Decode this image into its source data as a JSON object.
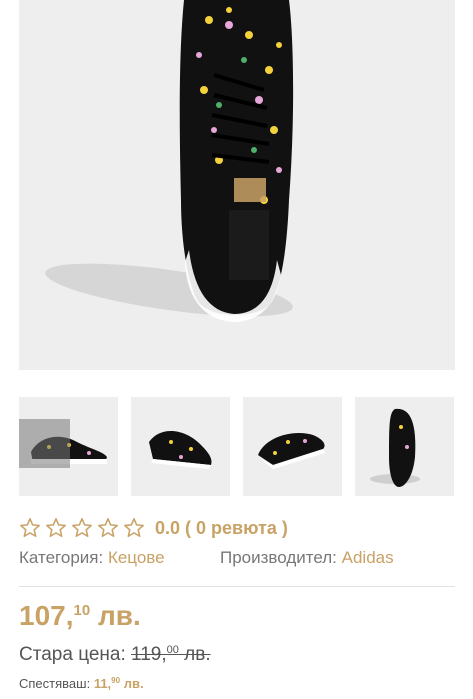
{
  "product": {
    "images": {
      "main_alt": "",
      "thumbnails_count": 4
    },
    "rating": {
      "stars_filled": 0,
      "stars_total": 5,
      "text": "0.0 ( 0 ревюта )"
    },
    "category": {
      "label": "Категория:",
      "value": "Кецове"
    },
    "manufacturer": {
      "label": "Производител:",
      "value": "Adidas"
    },
    "price": {
      "main": "107,",
      "cents": "10",
      "currency": "лв."
    },
    "old_price": {
      "label": "Стара цена:",
      "main": "119,",
      "cents": "00",
      "currency": "лв."
    },
    "saved": {
      "label": "Спестяваш:",
      "main": "11,",
      "cents": "90",
      "currency": "лв."
    }
  },
  "colors": {
    "accent": "#c9a266",
    "image_bg": "#eeeeee"
  }
}
